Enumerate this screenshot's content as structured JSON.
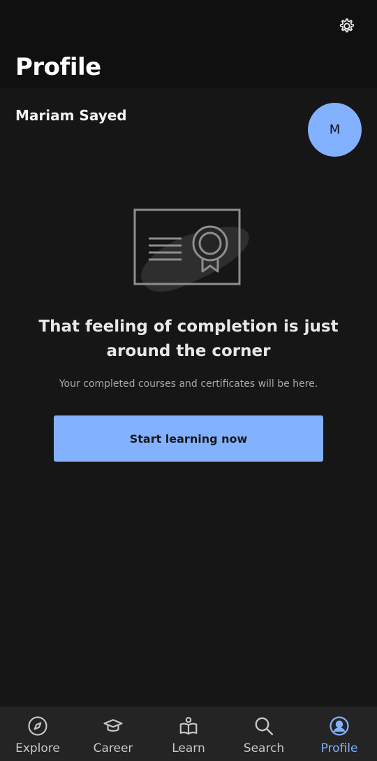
{
  "header": {
    "title": "Profile",
    "settings_icon": "gear-icon"
  },
  "user": {
    "name": "Mariam Sayed",
    "avatar_initial": "M",
    "avatar_color": "#82b1ff"
  },
  "empty_state": {
    "illustration_icon": "certificate-icon",
    "heading": "That feeling of completion is just around the corner",
    "subtext": "Your completed courses and certificates will be here.",
    "cta_label": "Start learning now"
  },
  "nav": {
    "items": [
      {
        "label": "Explore",
        "icon": "compass-icon",
        "active": false
      },
      {
        "label": "Career",
        "icon": "graduation-cap-icon",
        "active": false
      },
      {
        "label": "Learn",
        "icon": "book-reader-icon",
        "active": false
      },
      {
        "label": "Search",
        "icon": "search-icon",
        "active": false
      },
      {
        "label": "Profile",
        "icon": "profile-icon",
        "active": true
      }
    ]
  },
  "colors": {
    "accent": "#82b1ff",
    "background": "#161616",
    "header_background": "#101010",
    "nav_background": "#242424"
  }
}
